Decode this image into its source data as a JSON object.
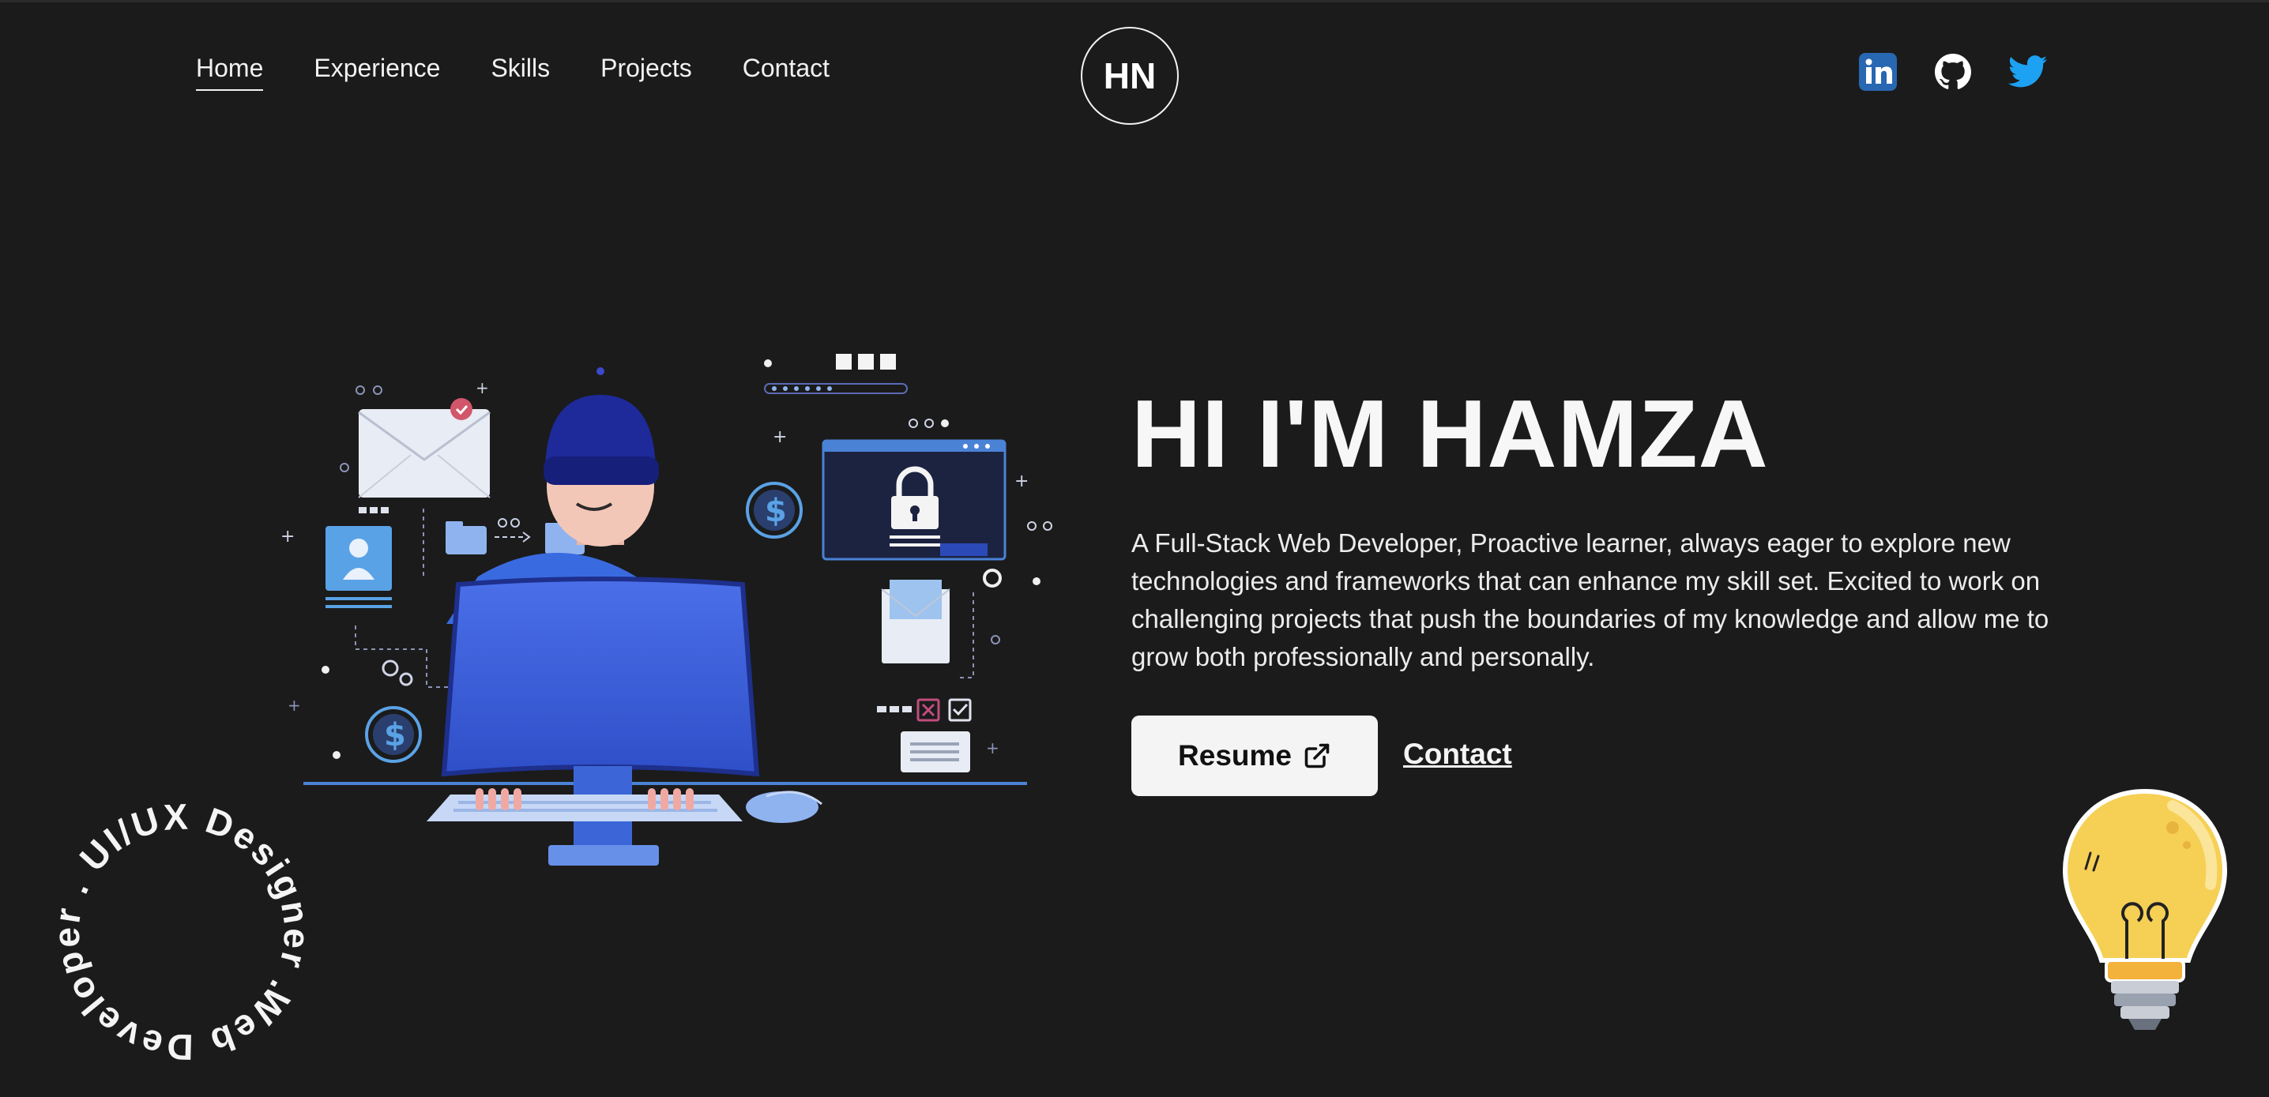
{
  "nav": {
    "items": [
      {
        "label": "Home",
        "active": true
      },
      {
        "label": "Experience"
      },
      {
        "label": "Skills"
      },
      {
        "label": "Projects"
      },
      {
        "label": "Contact"
      }
    ]
  },
  "logo": {
    "text": "HN"
  },
  "social": {
    "icons": [
      "linkedin-icon",
      "github-icon",
      "twitter-icon"
    ],
    "colors": {
      "linkedin": "#2867b2",
      "github": "#ffffff",
      "twitter": "#1da1f2"
    }
  },
  "hero": {
    "title": "HI I'M HAMZA",
    "description": "A Full-Stack Web Developer, Proactive learner, always eager to explore new technologies and frameworks that can enhance my skill set. Excited to work on challenging projects that push the boundaries of my knowledge and allow me to grow both professionally and personally.",
    "resume_label": "Resume",
    "contact_label": "Contact"
  },
  "badge": {
    "circular_text": "Web Developer . UI/UX Designer . "
  },
  "colors": {
    "background": "#1b1b1b",
    "text": "#f5f5f5",
    "button_bg": "#f4f4f4",
    "accent_blue": "#3f6fe0"
  }
}
